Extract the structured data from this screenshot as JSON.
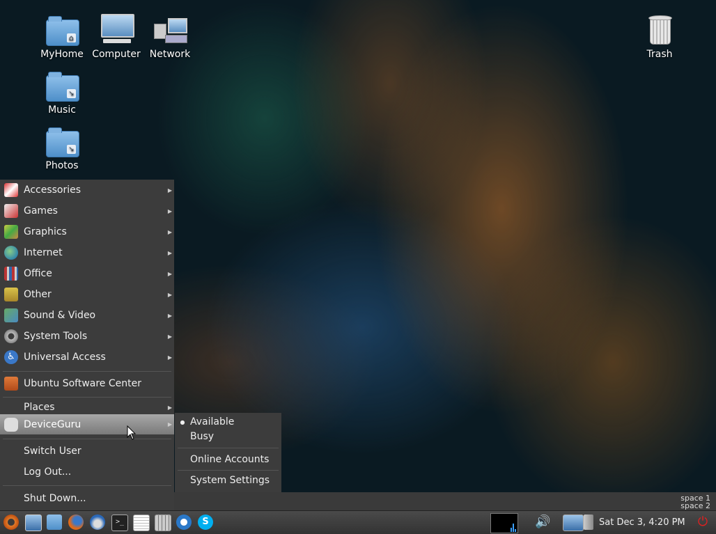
{
  "desktop_icons": [
    {
      "label": "MyHome",
      "icon": "home-folder-icon"
    },
    {
      "label": "Computer",
      "icon": "computer-icon"
    },
    {
      "label": "Network",
      "icon": "network-icon"
    },
    {
      "label": "Music",
      "icon": "music-folder-icon"
    },
    {
      "label": "Photos",
      "icon": "photos-folder-icon"
    },
    {
      "label": "Trash",
      "icon": "trash-icon"
    }
  ],
  "menu": {
    "items": [
      {
        "label": "Accessories",
        "icon": "accessories-icon"
      },
      {
        "label": "Games",
        "icon": "games-icon"
      },
      {
        "label": "Graphics",
        "icon": "graphics-icon"
      },
      {
        "label": "Internet",
        "icon": "internet-icon"
      },
      {
        "label": "Office",
        "icon": "office-icon"
      },
      {
        "label": "Other",
        "icon": "other-icon"
      },
      {
        "label": "Sound & Video",
        "icon": "sound-video-icon"
      },
      {
        "label": "System Tools",
        "icon": "system-tools-icon"
      },
      {
        "label": "Universal Access",
        "icon": "universal-access-icon"
      },
      {
        "label": "Ubuntu Software Center",
        "icon": "software-center-icon"
      },
      {
        "label": "Places"
      },
      {
        "label": "DeviceGuru",
        "icon": "user-chat-icon"
      },
      {
        "label": "Switch User"
      },
      {
        "label": "Log Out..."
      },
      {
        "label": "Shut Down..."
      }
    ]
  },
  "submenu": {
    "items": [
      {
        "label": "Available",
        "selected": true
      },
      {
        "label": "Busy"
      },
      {
        "label": "Online Accounts"
      },
      {
        "label": "System Settings"
      }
    ]
  },
  "workspaces": [
    "space 1",
    "space 2"
  ],
  "taskbar": {
    "clock": "Sat Dec  3,  4:20 PM",
    "launchers": [
      "main-menu-icon",
      "show-desktop-icon",
      "file-manager-icon",
      "firefox-icon",
      "thunderbird-icon",
      "terminal-icon",
      "text-editor-icon",
      "calculator-icon",
      "wifi-icon",
      "skype-icon"
    ],
    "tray": [
      "cpu-monitor-icon",
      "volume-icon",
      "network-status-icon",
      "battery-icon",
      "power-icon"
    ]
  },
  "colors": {
    "menu_bg": "#3c3c3c",
    "menu_active": "#8f8f8f",
    "accent_power": "#e02020"
  }
}
